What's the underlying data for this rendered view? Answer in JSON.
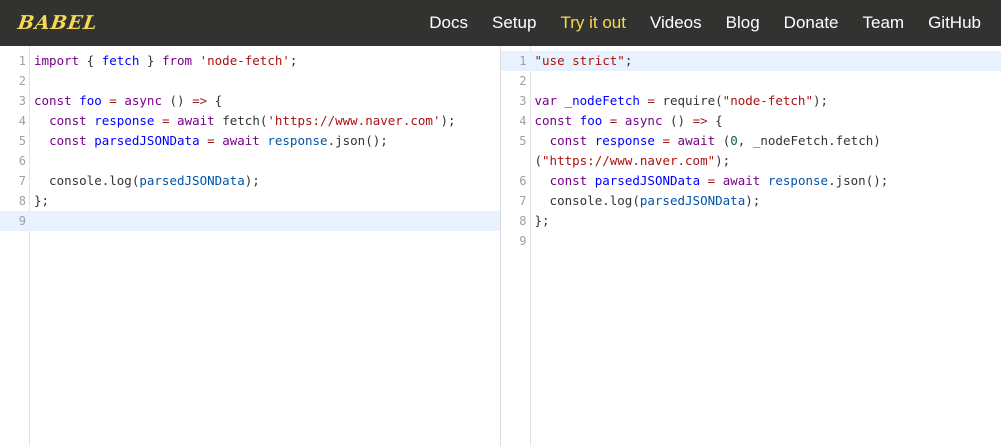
{
  "header": {
    "logo": "BABEL",
    "nav": [
      {
        "label": "Docs"
      },
      {
        "label": "Setup"
      },
      {
        "label": "Try it out",
        "active": true
      },
      {
        "label": "Videos"
      },
      {
        "label": "Blog"
      },
      {
        "label": "Donate"
      },
      {
        "label": "Team"
      },
      {
        "label": "GitHub"
      }
    ]
  },
  "colors": {
    "navbar_bg": "#323330",
    "accent": "#f5da55",
    "active_line": "#e8f2fe"
  },
  "input_editor": {
    "lines": [
      {
        "n": "1",
        "tokens": [
          [
            "kw",
            "import"
          ],
          [
            "p",
            " { "
          ],
          [
            "def",
            "fetch"
          ],
          [
            "p",
            " } "
          ],
          [
            "kw",
            "from"
          ],
          [
            "p",
            " "
          ],
          [
            "str",
            "'node-fetch'"
          ],
          [
            "p",
            ";"
          ]
        ]
      },
      {
        "n": "2",
        "tokens": []
      },
      {
        "n": "3",
        "tokens": [
          [
            "kw",
            "const"
          ],
          [
            "p",
            " "
          ],
          [
            "def",
            "foo"
          ],
          [
            "p",
            " "
          ],
          [
            "op",
            "="
          ],
          [
            "p",
            " "
          ],
          [
            "kw",
            "async"
          ],
          [
            "p",
            " () "
          ],
          [
            "op",
            "=>"
          ],
          [
            "p",
            " {"
          ]
        ]
      },
      {
        "n": "4",
        "tokens": [
          [
            "p",
            "  "
          ],
          [
            "kw",
            "const"
          ],
          [
            "p",
            " "
          ],
          [
            "def",
            "response"
          ],
          [
            "p",
            " "
          ],
          [
            "op",
            "="
          ],
          [
            "p",
            " "
          ],
          [
            "kw",
            "await"
          ],
          [
            "p",
            " fetch("
          ],
          [
            "str",
            "'https://www.naver.com'"
          ],
          [
            "p",
            ");"
          ]
        ]
      },
      {
        "n": "5",
        "tokens": [
          [
            "p",
            "  "
          ],
          [
            "kw",
            "const"
          ],
          [
            "p",
            " "
          ],
          [
            "def",
            "parsedJSONData"
          ],
          [
            "p",
            " "
          ],
          [
            "op",
            "="
          ],
          [
            "p",
            " "
          ],
          [
            "kw",
            "await"
          ],
          [
            "p",
            " "
          ],
          [
            "var2",
            "response"
          ],
          [
            "p",
            ".json();"
          ]
        ]
      },
      {
        "n": "6",
        "tokens": []
      },
      {
        "n": "7",
        "tokens": [
          [
            "p",
            "  console.log("
          ],
          [
            "var2",
            "parsedJSONData"
          ],
          [
            "p",
            ");"
          ]
        ]
      },
      {
        "n": "8",
        "tokens": [
          [
            "p",
            "};"
          ]
        ]
      },
      {
        "n": "9",
        "tokens": [],
        "active": true
      }
    ]
  },
  "output_editor": {
    "lines": [
      {
        "n": "1",
        "tokens": [
          [
            "str",
            "\"use strict\""
          ],
          [
            "p",
            ";"
          ]
        ],
        "active": true
      },
      {
        "n": "2",
        "tokens": []
      },
      {
        "n": "3",
        "tokens": [
          [
            "kw",
            "var"
          ],
          [
            "p",
            " "
          ],
          [
            "def",
            "_nodeFetch"
          ],
          [
            "p",
            " "
          ],
          [
            "op",
            "="
          ],
          [
            "p",
            " require("
          ],
          [
            "str",
            "\"node-fetch\""
          ],
          [
            "p",
            ");"
          ]
        ]
      },
      {
        "n": "4",
        "tokens": [
          [
            "kw",
            "const"
          ],
          [
            "p",
            " "
          ],
          [
            "def",
            "foo"
          ],
          [
            "p",
            " "
          ],
          [
            "op",
            "="
          ],
          [
            "p",
            " "
          ],
          [
            "kw",
            "async"
          ],
          [
            "p",
            " () "
          ],
          [
            "op",
            "=>"
          ],
          [
            "p",
            " {"
          ]
        ]
      },
      {
        "n": "5",
        "tokens": [
          [
            "p",
            "  "
          ],
          [
            "kw",
            "const"
          ],
          [
            "p",
            " "
          ],
          [
            "def",
            "response"
          ],
          [
            "p",
            " "
          ],
          [
            "op",
            "="
          ],
          [
            "p",
            " "
          ],
          [
            "kw",
            "await"
          ],
          [
            "p",
            " ("
          ],
          [
            "num",
            "0"
          ],
          [
            "p",
            ", _nodeFetch.fetch)"
          ]
        ]
      },
      {
        "n": "",
        "tokens": [
          [
            "p",
            "("
          ],
          [
            "str",
            "\"https://www.naver.com\""
          ],
          [
            "p",
            ");"
          ]
        ],
        "wrapped": true
      },
      {
        "n": "6",
        "tokens": [
          [
            "p",
            "  "
          ],
          [
            "kw",
            "const"
          ],
          [
            "p",
            " "
          ],
          [
            "def",
            "parsedJSONData"
          ],
          [
            "p",
            " "
          ],
          [
            "op",
            "="
          ],
          [
            "p",
            " "
          ],
          [
            "kw",
            "await"
          ],
          [
            "p",
            " "
          ],
          [
            "var2",
            "response"
          ],
          [
            "p",
            ".json();"
          ]
        ]
      },
      {
        "n": "7",
        "tokens": [
          [
            "p",
            "  console.log("
          ],
          [
            "var2",
            "parsedJSONData"
          ],
          [
            "p",
            ");"
          ]
        ]
      },
      {
        "n": "8",
        "tokens": [
          [
            "p",
            "};"
          ]
        ]
      },
      {
        "n": "9",
        "tokens": []
      }
    ]
  }
}
